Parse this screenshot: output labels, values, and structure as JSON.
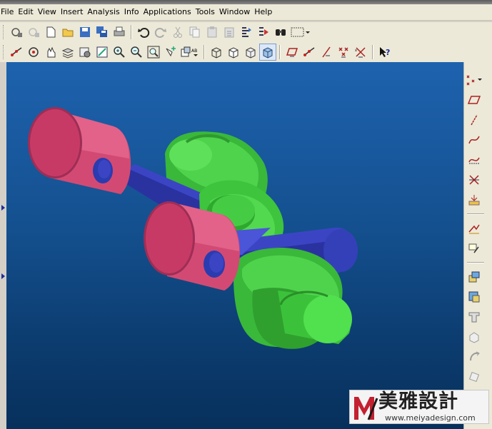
{
  "menubar": {
    "items": [
      "File",
      "Edit",
      "View",
      "Insert",
      "Analysis",
      "Info",
      "Applications",
      "Tools",
      "Window",
      "Help"
    ]
  },
  "toolbar_row1": {
    "icons": [
      "new-part-icon",
      "open-cloud-icon",
      "blank-page-icon",
      "open-folder-icon",
      "save-icon",
      "save-all-icon",
      "print-icon",
      "undo-icon",
      "redo-icon",
      "cut-icon",
      "copy-icon",
      "paste-icon",
      "paste-special-icon",
      "display-info-icon",
      "relations-icon",
      "binoculars-icon",
      "select-box-icon"
    ]
  },
  "toolbar_row2": {
    "icons": [
      "point-constructor-icon",
      "rotate-snap-icon",
      "pan-icon",
      "layers-icon",
      "screenshot-icon",
      "edit-display-icon",
      "zoom-in-icon",
      "zoom-out-icon",
      "fit-view-icon",
      "snap-view-icon",
      "render-style-icon",
      "wireframe-icon",
      "hidden-lines-icon",
      "static-wireframe-icon",
      "shaded-cube-icon",
      "datum-plane-icon",
      "datum-axis-icon",
      "line-tool-icon",
      "intersection-point-icon",
      "xyz-point-icon",
      "whats-this-icon"
    ],
    "active": "shaded-cube-icon"
  },
  "right_toolbar": {
    "icons": [
      "point-set-icon",
      "plane-icon",
      "line-icon",
      "spline-icon",
      "curve-fit-icon",
      "intersect-curve-icon",
      "measure-icon",
      "sketch-icon",
      "offset-curve-icon",
      "extrude-icon",
      "revolve-icon",
      "sweep-icon",
      "chamfer-icon",
      "blend-icon",
      "trim-icon"
    ]
  },
  "watermark": {
    "brand": "美雅設計",
    "url": "www.meiyadesign.com"
  },
  "colors": {
    "piston": "#d44b73",
    "rod": "#3b45c4",
    "crank": "#3ec43d",
    "viewport_top": "#1e62ae",
    "viewport_bottom": "#07305c"
  }
}
